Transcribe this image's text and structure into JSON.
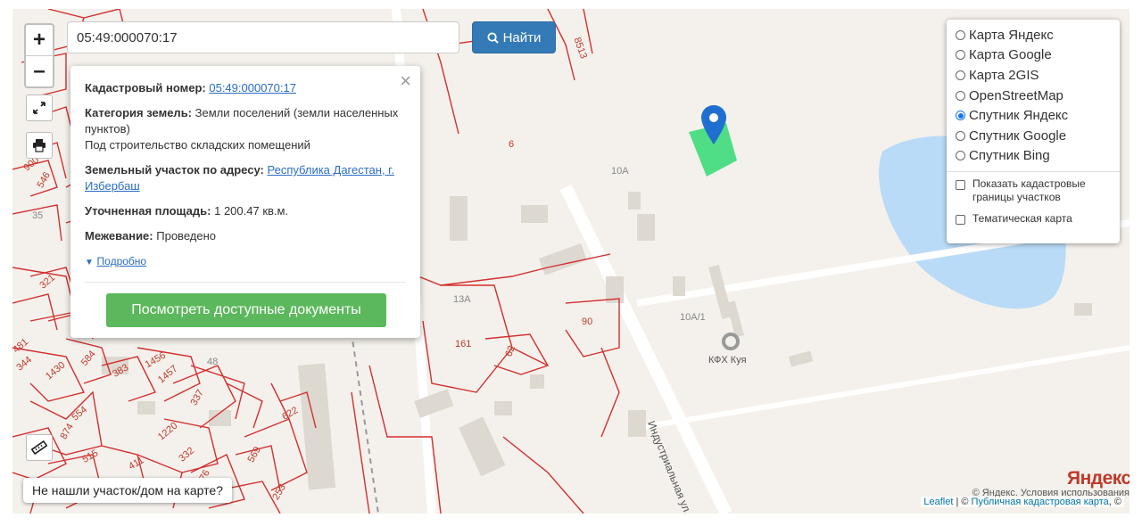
{
  "colors": {
    "accent": "#337ab7",
    "docs_button": "#5cb85c",
    "parcel_line": "#d32f2f",
    "selected_parcel": "#3ddc7a",
    "water": "#b9dbf7",
    "marker": "#1f6fd1"
  },
  "search": {
    "value": "05:49:000070:17",
    "button_label": "Найти"
  },
  "zoom": {
    "in_label": "+",
    "out_label": "–"
  },
  "popup": {
    "cad_label": "Кадастровый номер:",
    "cad_value": "05:49:000070:17",
    "cat_label": "Категория земель:",
    "cat_value": "Земли поселений (земли населенных пунктов)",
    "use_value": "Под строительство складских помещений",
    "addr_label": "Земельный участок по адресу:",
    "addr_value": "Республика Дагестан, г. Избербаш",
    "area_label": "Уточненная площадь:",
    "area_value": "1 200.47 кв.м.",
    "survey_label": "Межевание:",
    "survey_value": "Проведено",
    "details_label": "Подробно",
    "docs_button": "Посмотреть доступные документы"
  },
  "layers": {
    "options": [
      "Карта Яндекс",
      "Карта Google",
      "Карта 2GIS",
      "OpenStreetMap",
      "Спутник Яндекс",
      "Спутник Google",
      "Спутник Bing"
    ],
    "selected": "Спутник Яндекс",
    "checkbox_cadastral": "Показать кадастровые границы участков",
    "checkbox_thematic": "Тематическая карта"
  },
  "not_found_label": "Не нашли участок/дом на карте?",
  "attribution": {
    "leaflet": "Leaflet",
    "separator": " | © ",
    "pkk": "Публичная кадастровая карта",
    "suffix": ", ©"
  },
  "yandex": {
    "logo": "Яндекс",
    "terms": "© Яндекс. Условия использования"
  },
  "map_labels": {
    "street": "Индустриальная ул.",
    "poi": "КФХ Куя",
    "parcels": [
      "8513",
      "6",
      "10А",
      "35",
      "13А",
      "90",
      "10А/1",
      "161",
      "62",
      "321",
      "481",
      "344",
      "1430",
      "584",
      "383",
      "1456",
      "1457",
      "48",
      "337",
      "554",
      "874",
      "622",
      "1220",
      "332",
      "515",
      "411",
      "476",
      "569",
      "253",
      "900",
      "546"
    ]
  }
}
